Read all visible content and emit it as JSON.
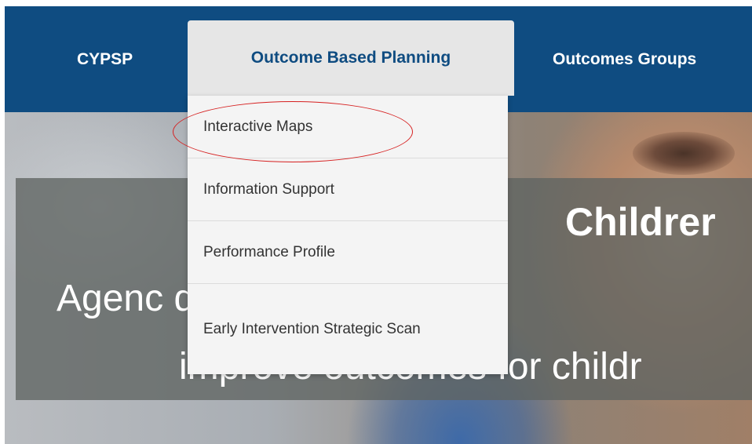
{
  "navbar": {
    "items": [
      {
        "label": "CYPSP"
      },
      {
        "label": "Outcome Based Planning"
      },
      {
        "label": "Outcomes Groups"
      }
    ],
    "background_color": "#0f4c81",
    "active_background_color": "#e6e6e6"
  },
  "dropdown": {
    "items": [
      {
        "label": "Interactive Maps"
      },
      {
        "label": "Information Support"
      },
      {
        "label": "Performance Profile"
      },
      {
        "label": "Early Intervention Strategic Scan"
      }
    ]
  },
  "hero": {
    "title": "Childrer",
    "line1": "Agenc                         d young peo",
    "line2": "improve outcomes for childr"
  },
  "annotation": {
    "highlight_color": "#d62020"
  }
}
